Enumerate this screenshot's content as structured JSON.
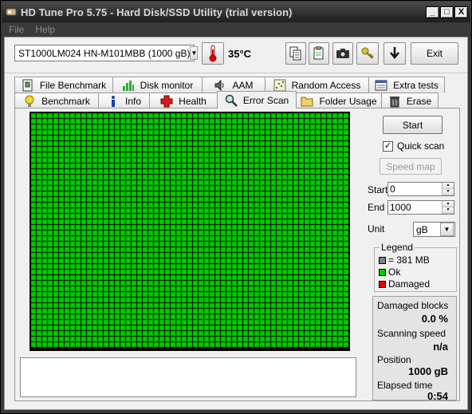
{
  "window": {
    "title": "HD Tune Pro 5.75 - Hard Disk/SSD Utility (trial version)",
    "controls": {
      "minimize": "_",
      "maximize": "□",
      "close": "X"
    }
  },
  "menu": [
    {
      "label": "File"
    },
    {
      "label": "Help"
    }
  ],
  "toolbar": {
    "drive": "ST1000LM024 HN-M101MBB (1000 gB)",
    "temperature": "35°C",
    "exit_label": "Exit",
    "icons": [
      "copy-text-icon",
      "copy-info-icon",
      "screenshot-camera-icon",
      "options-key-icon",
      "save-download-icon"
    ]
  },
  "tabs": {
    "row_top": [
      {
        "label": "File Benchmark",
        "icon": "file-benchmark-icon"
      },
      {
        "label": "Disk monitor",
        "icon": "disk-monitor-icon"
      },
      {
        "label": "AAM",
        "icon": "speaker-icon"
      },
      {
        "label": "Random Access",
        "icon": "random-access-icon"
      },
      {
        "label": "Extra tests",
        "icon": "extra-tests-icon"
      }
    ],
    "row_bottom": [
      {
        "label": "Benchmark",
        "icon": "lightbulb-icon"
      },
      {
        "label": "Info",
        "icon": "info-icon"
      },
      {
        "label": "Health",
        "icon": "health-cross-icon"
      },
      {
        "label": "Error Scan",
        "icon": "magnifier-icon",
        "active": true
      },
      {
        "label": "Folder Usage",
        "icon": "folder-icon"
      },
      {
        "label": "Erase",
        "icon": "trash-icon"
      }
    ]
  },
  "scan": {
    "start_button": "Start",
    "quick_scan_label": "Quick scan",
    "quick_scan_checked": true,
    "speed_map_button": "Speed map",
    "start_label": "Start",
    "start_value": "0",
    "end_label": "End",
    "end_value": "1000",
    "unit_label": "Unit",
    "unit_value": "gB"
  },
  "legend": {
    "title": "Legend",
    "items": [
      {
        "label": "= 381 MB",
        "color": "#808080"
      },
      {
        "label": "Ok",
        "color": "#00cc00"
      },
      {
        "label": "Damaged",
        "color": "#ee0000"
      }
    ]
  },
  "stats": {
    "damaged_blocks_label": "Damaged blocks",
    "damaged_blocks_value": "0.0 %",
    "scanning_speed_label": "Scanning speed",
    "scanning_speed_value": "n/a",
    "position_label": "Position",
    "position_value": "1000 gB",
    "elapsed_label": "Elapsed time",
    "elapsed_value": "0:54"
  },
  "block_map": {
    "status": "all ok",
    "ok_color": "#00cc00",
    "grid_color": "#000000"
  }
}
